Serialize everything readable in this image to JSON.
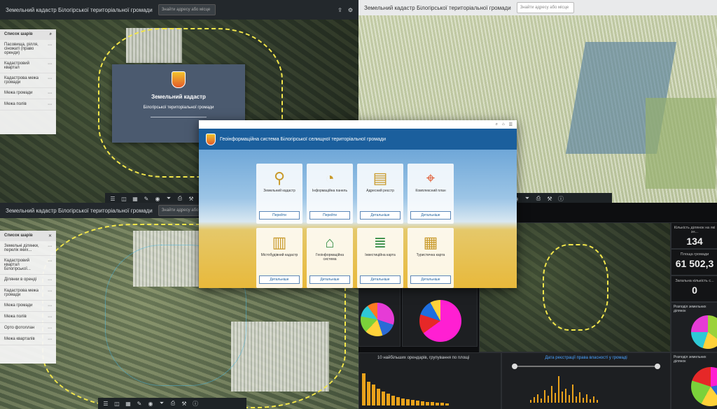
{
  "top_left": {
    "title": "Земельний кадастр Білогірської територіальної громади",
    "search_placeholder": "Знайти адресу або місце",
    "splash_title": "Земельний кадастр",
    "splash_subtitle": "Білогірської територіальної громади",
    "layer_list_title": "Список шарів",
    "layers": [
      "Пасовища, рілля, сіножаті (право оренди)",
      "Кадастровий квартал",
      "Кадастрова межа громади",
      "Межа громади",
      "Межа полів"
    ]
  },
  "top_right": {
    "search_placeholder": "Знайти адресу або місце"
  },
  "bottom_left": {
    "title": "Земельний кадастр Білогірської територіальної громади",
    "search_placeholder": "Знайти адресу або місце",
    "layer_list_title": "Список шарів",
    "layers": [
      "Земельні ділянки, перелік яких...",
      "Кадастровий квартал Білогірської...",
      "Ділянки в оренді",
      "Кадастрова межа громади",
      "Межа громади",
      "Межа полів",
      "Орто фотоплан",
      "Межа кварталів"
    ]
  },
  "portal": {
    "title": "Геоінформаційна система Білогірської селищної територіальної громади",
    "cards": [
      {
        "label": "Земельний кадастр",
        "button": "Перейти",
        "icon": "survey-icon"
      },
      {
        "label": "Інформаційна панель",
        "button": "Перейти",
        "icon": "dashboard-icon"
      },
      {
        "label": "Адресний реєстр",
        "button": "Детальніше",
        "icon": "address-icon"
      },
      {
        "label": "Комплексний план",
        "button": "Детальніше",
        "icon": "location-icon"
      },
      {
        "label": "Містобудівний кадастр",
        "button": "Детальніше",
        "icon": "urban-icon"
      },
      {
        "label": "Геоінформаційна система",
        "button": "Детальніше",
        "icon": "gis-icon"
      },
      {
        "label": "Інвестиційна карта",
        "button": "Детальніше",
        "icon": "invest-icon"
      },
      {
        "label": "Туристична карта",
        "button": "Детальніше",
        "icon": "tourist-icon"
      }
    ]
  },
  "dashboard": {
    "stat1_label": "Кількість ділянок на які зн...",
    "stat1_value": "134",
    "stat2_label": "Площа громади",
    "stat2_value": "61 502,3",
    "stat3_label": "Загальна кількість с...",
    "stat3_value": "0",
    "pie_panel_right_title": "Розподіл земельних ділянок",
    "pie_panel_right2_title": "Розподіл земельних ділянок",
    "bar_title": "10 найбільших орендарів, групування по площі",
    "line_title": "Дата реєстрації права власності у громаді"
  },
  "colors": {
    "portal_header": "#1b5f9d",
    "dashboard_bg": "#1d1f22",
    "accent_orange": "#e9a21b"
  }
}
